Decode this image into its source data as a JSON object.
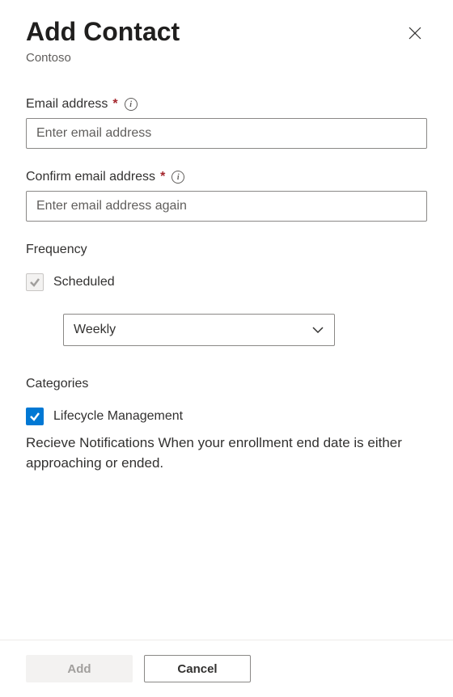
{
  "header": {
    "title": "Add Contact",
    "subtitle": "Contoso"
  },
  "fields": {
    "email": {
      "label": "Email address",
      "required_marker": "*",
      "placeholder": "Enter email address",
      "value": ""
    },
    "confirm_email": {
      "label": "Confirm email address",
      "required_marker": "*",
      "placeholder": "Enter email address again",
      "value": ""
    }
  },
  "frequency": {
    "section_label": "Frequency",
    "scheduled_label": "Scheduled",
    "dropdown_value": "Weekly"
  },
  "categories": {
    "section_label": "Categories",
    "lifecycle_label": "Lifecycle Management",
    "lifecycle_description": "Recieve Notifications When your enrollment end date is either approaching or ended."
  },
  "footer": {
    "add_label": "Add",
    "cancel_label": "Cancel"
  }
}
